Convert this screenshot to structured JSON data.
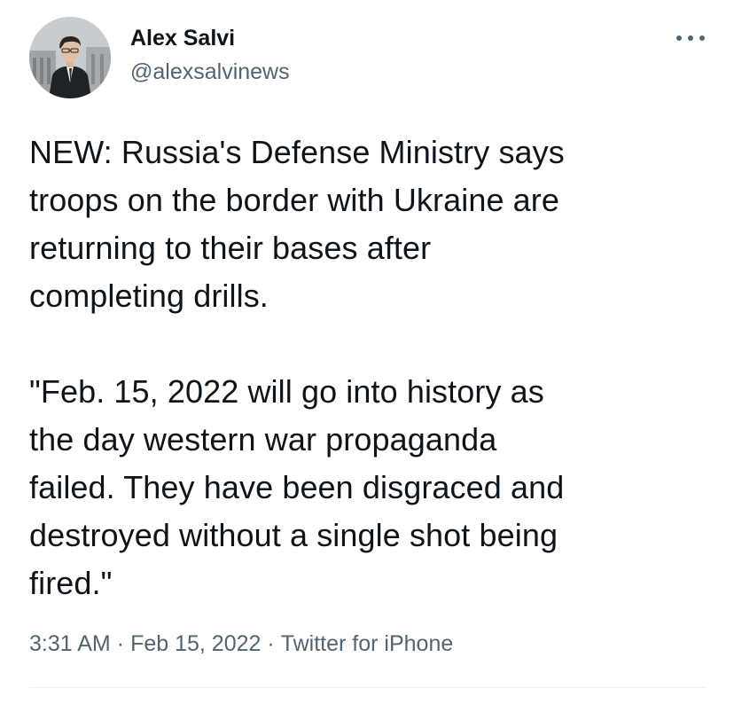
{
  "user": {
    "display_name": "Alex Salvi",
    "handle": "@alexsalvinews",
    "avatar_icon": "profile-photo-icon"
  },
  "tweet": {
    "paragraph1_lines": [
      "NEW: Russia's Defense Ministry says",
      "troops on the border with Ukraine are",
      "returning to their bases after",
      "completing drills."
    ],
    "paragraph2_lines": [
      "\"Feb. 15, 2022 will go into history as",
      "the day western war propaganda",
      "failed. They have been disgraced and",
      "destroyed without a single shot being",
      "fired.\""
    ]
  },
  "meta": {
    "time": "3:31 AM",
    "separator": "·",
    "date": "Feb 15, 2022",
    "source": "Twitter for iPhone"
  },
  "more_icon": "more-horizontal-icon",
  "colors": {
    "text_primary": "#0f1419",
    "text_secondary": "#536471",
    "divider": "#eff3f4"
  }
}
